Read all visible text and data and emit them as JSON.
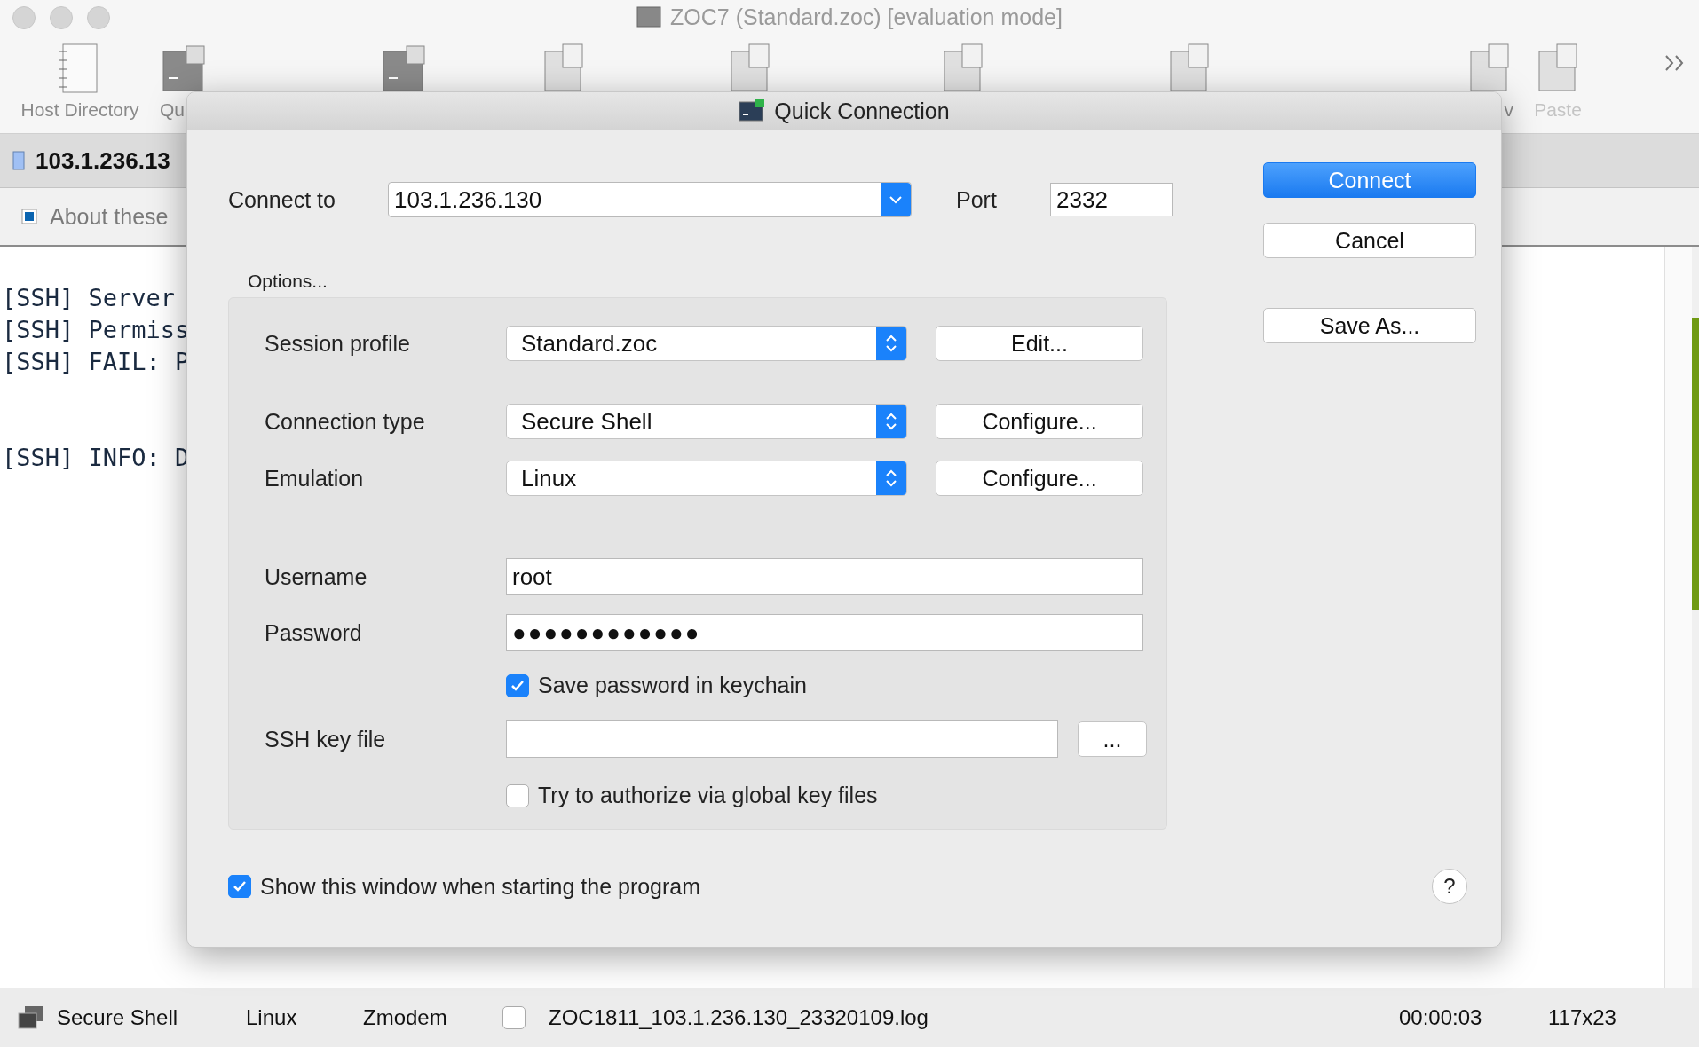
{
  "window": {
    "title": "ZOC7 (Standard.zoc) [evaluation mode]"
  },
  "toolbar": [
    {
      "kind": "address-book",
      "label": "Host Directory",
      "disabled": false
    },
    {
      "kind": "terminal",
      "label": "Qu",
      "disabled": false
    },
    {
      "kind": "terminal"
    },
    {
      "kind": "document"
    },
    {
      "kind": "document"
    },
    {
      "kind": "document"
    },
    {
      "kind": "document"
    },
    {
      "kind": "document",
      "label": "v",
      "disabled": false
    },
    {
      "kind": "document",
      "label": "Paste",
      "disabled": true
    }
  ],
  "session_tab": {
    "label": "103.1.236.13"
  },
  "info_bar": {
    "label": "About these"
  },
  "terminal": {
    "blocks": [
      [
        "[SSH] Server",
        "[SSH] Permiss",
        "[SSH] FAIL: P"
      ],
      [
        "[SSH] INFO: D"
      ]
    ]
  },
  "status_bar": {
    "connection_type": "Secure Shell",
    "emulation": "Linux",
    "transfer": "Zmodem",
    "logging": {
      "checked": false,
      "file": "ZOC1811_103.1.236.130_23320109.log"
    },
    "elapsed": "00:00:03",
    "size": "117x23"
  },
  "dialog": {
    "title": "Quick Connection",
    "connect_to": {
      "label": "Connect to",
      "value": "103.1.236.130"
    },
    "port": {
      "label": "Port",
      "value": "2332"
    },
    "buttons": [
      {
        "label": "Connect",
        "default": true
      },
      {
        "label": "Cancel",
        "default": false
      },
      {
        "label": "Save As...",
        "default": false
      }
    ],
    "options_label": "Options...",
    "selects": [
      {
        "label": "Session profile",
        "value": "Standard.zoc",
        "button": "Edit..."
      },
      {
        "label": "Connection type",
        "value": "Secure Shell",
        "button": "Configure..."
      },
      {
        "label": "Emulation",
        "value": "Linux",
        "button": "Configure..."
      }
    ],
    "username": {
      "label": "Username",
      "value": "root"
    },
    "password": {
      "label": "Password",
      "value": "●●●●●●●●●●●●"
    },
    "save_password": {
      "label": "Save password in keychain",
      "checked": true
    },
    "ssh_key": {
      "label": "SSH key file",
      "button": "..."
    },
    "global_keys": {
      "label": "Try to authorize via global key files",
      "checked": false
    },
    "show_on_start": {
      "label": "Show this window when starting the program",
      "checked": true
    },
    "help": "?"
  }
}
